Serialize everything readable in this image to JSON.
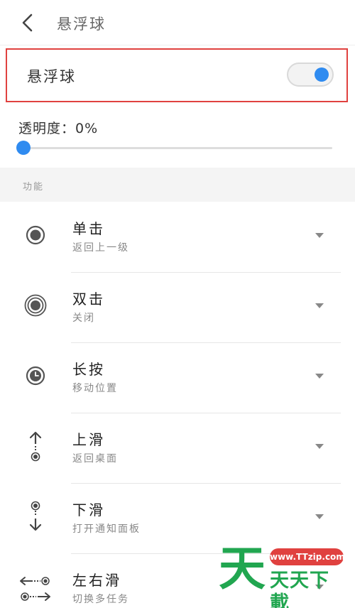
{
  "header": {
    "title": "悬浮球",
    "back_icon": "chevron-left-icon"
  },
  "toggle": {
    "label": "悬浮球",
    "state": "on",
    "accent": "#2f8bf0"
  },
  "opacity": {
    "label": "透明度：0%",
    "value_percent": 0
  },
  "section": {
    "label": "功能"
  },
  "functions": [
    {
      "name": "单击",
      "desc": "返回上一级",
      "icon": "dot-circle-icon"
    },
    {
      "name": "双击",
      "desc": "关闭",
      "icon": "double-circle-icon"
    },
    {
      "name": "长按",
      "desc": "移动位置",
      "icon": "clock-icon"
    },
    {
      "name": "上滑",
      "desc": "返回桌面",
      "icon": "swipe-up-icon"
    },
    {
      "name": "下滑",
      "desc": "打开通知面板",
      "icon": "swipe-down-icon"
    },
    {
      "name": "左右滑",
      "desc": "切换多任务",
      "icon": "swipe-left-right-icon"
    }
  ],
  "watermark": {
    "logo_char": "天",
    "url": "www.TTzip.com",
    "text": "天天下載"
  },
  "colors": {
    "highlight_border": "#e0413f",
    "watermark_green": "#21a650"
  }
}
